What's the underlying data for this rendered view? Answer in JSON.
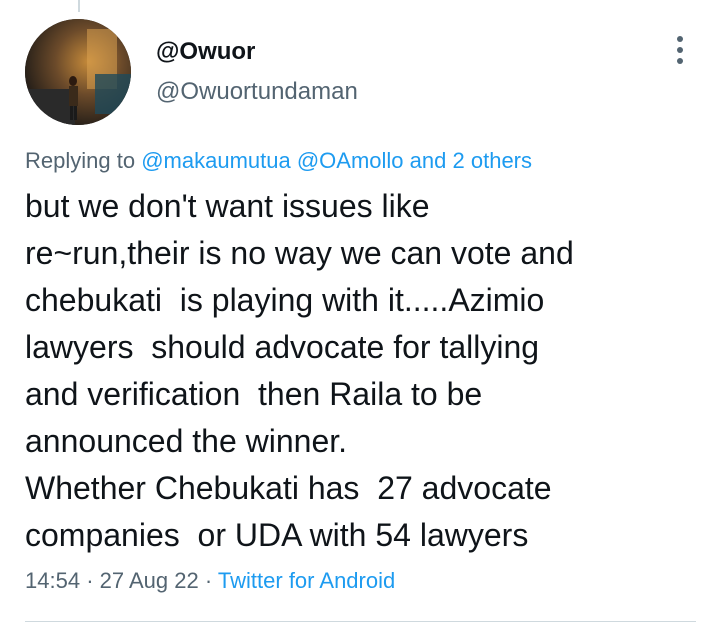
{
  "user": {
    "display_name": "@Owuor",
    "handle": "@Owuortundaman"
  },
  "reply": {
    "prefix": "Replying to",
    "mention_1": "@makaumutua",
    "mention_2": "@OAmollo",
    "joiner": "and",
    "others": "2 others"
  },
  "tweet": {
    "lines": [
      "but we don't want issues like",
      "re~run,their is no way we can vote and",
      "chebukati  is playing with it.....Azimio",
      "lawyers  should advocate for tallying",
      "and verification  then Raila to be",
      "announced the winner.",
      "Whether Chebukati has  27 advocate",
      "companies  or UDA with 54 lawyers"
    ]
  },
  "meta": {
    "time": "14:54",
    "separator": "·",
    "date": "27 Aug 22",
    "source": "Twitter for Android"
  },
  "icons": {
    "more": "more-vertical-icon",
    "avatar": "profile-photo"
  },
  "colors": {
    "link": "#1d9bf0",
    "secondary_text": "#536471",
    "primary_text": "#0f1419",
    "divider": "#cfd9de"
  }
}
